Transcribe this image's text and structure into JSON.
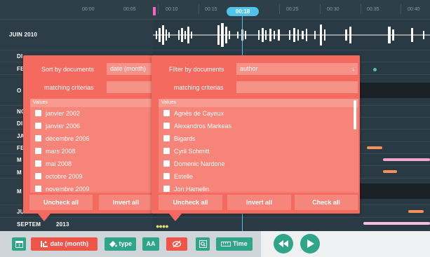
{
  "timeline": {
    "ruler_ticks": [
      "00:00",
      "00:05",
      "00:10",
      "00:15",
      "00:25",
      "00:30",
      "00:35",
      "00:40"
    ],
    "current_time": "00:18",
    "rows": [
      {
        "label": "JUIN 2010"
      },
      {
        "label": "DI"
      },
      {
        "label": "FE"
      },
      {
        "label": "O"
      },
      {
        "label": "NO"
      },
      {
        "label": "DI"
      },
      {
        "label": "JA"
      },
      {
        "label": "FE"
      },
      {
        "label": "M"
      },
      {
        "label": "M"
      },
      {
        "label": "M"
      },
      {
        "label": "JU"
      },
      {
        "label": "SEPTEM"
      },
      {
        "label": "2013"
      }
    ],
    "colors": {
      "playhead": "#4fc3e8",
      "popup": "#f46a5e",
      "toolbar_green": "#2fa58a"
    }
  },
  "sort_popup": {
    "title": "Sort by documents",
    "selected": "date (month)",
    "matching_label": "matching criterias",
    "matching_value": "",
    "values_header": "Values",
    "values": [
      "janvier 2002",
      "janvier 2006",
      "décembre 2006",
      "mars 2008",
      "mai 2008",
      "octobre 2009",
      "novembre 2009"
    ],
    "uncheck_all": "Uncheck all",
    "invert_all": "Invert all"
  },
  "filter_popup": {
    "title": "Filter by documents",
    "selected": "author",
    "arrow_icon": "↓",
    "matching_label": "matching criterias",
    "matching_value": "",
    "values_header": "Values",
    "values": [
      "Agnès de Cayeux",
      "Alexandros Markeas",
      "Bigards",
      "Cyril Schmitt",
      "Domenic Nardone",
      "Estelle",
      "Jon Hamelin"
    ],
    "uncheck_all": "Uncheck all",
    "invert_all": "Invert all",
    "check_all": "Check all"
  },
  "toolbar": {
    "calendar_icon": "calendar-icon",
    "sort_label": "date (month)",
    "type_label": "type",
    "font_label": "AA",
    "hide_icon": "eye-slash-icon",
    "search_icon": "search-icon",
    "time_label": "Time",
    "rewind_icon": "rewind-icon",
    "play_icon": "play-icon"
  }
}
